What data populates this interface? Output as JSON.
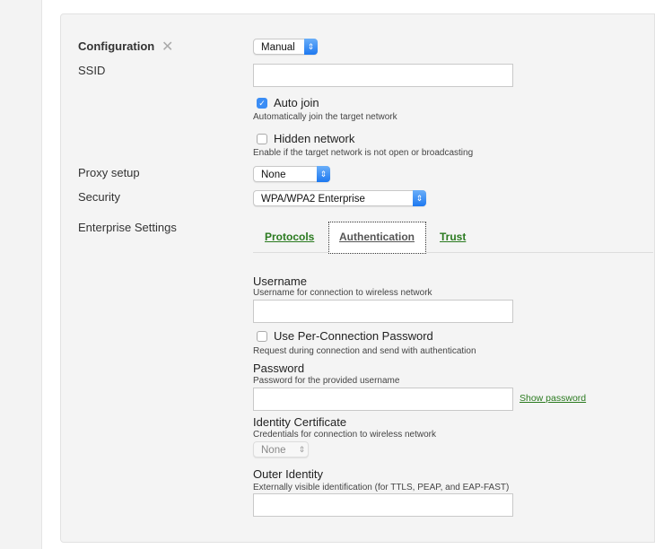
{
  "config": {
    "label": "Configuration",
    "mode": "Manual"
  },
  "ssid": {
    "label": "SSID",
    "value": ""
  },
  "auto_join": {
    "label": "Auto join",
    "help": "Automatically join the target network",
    "checked": true
  },
  "hidden_network": {
    "label": "Hidden network",
    "help": "Enable if the target network is not open or broadcasting",
    "checked": false
  },
  "proxy": {
    "label": "Proxy setup",
    "value": "None"
  },
  "security": {
    "label": "Security",
    "value": "WPA/WPA2 Enterprise"
  },
  "enterprise": {
    "label": "Enterprise Settings",
    "tabs": [
      {
        "label": "Protocols"
      },
      {
        "label": "Authentication",
        "active": true
      },
      {
        "label": "Trust"
      }
    ]
  },
  "username": {
    "title": "Username",
    "help": "Username for connection to wireless network",
    "value": ""
  },
  "per_conn_password": {
    "label": "Use Per-Connection Password",
    "help": "Request during connection and send with authentication",
    "checked": false
  },
  "password": {
    "title": "Password",
    "help": "Password for the provided username",
    "value": "",
    "show_label": "Show password"
  },
  "identity_cert": {
    "title": "Identity Certificate",
    "help": "Credentials for connection to wireless network",
    "value": "None"
  },
  "outer_identity": {
    "title": "Outer Identity",
    "help": "Externally visible identification (for TTLS, PEAP, and EAP-FAST)",
    "value": ""
  },
  "colors": {
    "accent": "#3b8df5",
    "link": "#2a7a1f",
    "panel": "#f4f4f4"
  }
}
